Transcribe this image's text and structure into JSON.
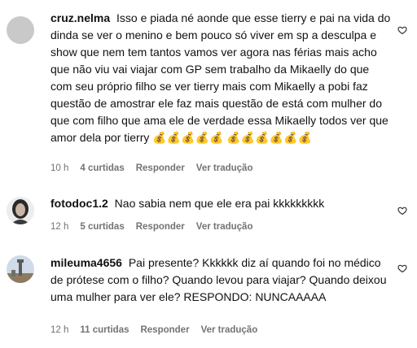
{
  "comments": [
    {
      "username": "cruz.nelma",
      "text": "Isso e piada né aonde que esse tierry e pai na vida do dinda se ver o menino e bem pouco só viver em sp a desculpa e show que nem tem tantos vamos ver agora nas férias mais acho que não viu vai viajar com GP sem trabalho da Mikaelly do que com seu próprio filho se ver tierry mais com Mikaelly a pobi faz questão de amostrar ele faz mais questão de está com mulher do que com filho que ama ele de verdade essa Mikaelly todos ver que amor dela por tierry 💰💰💰💰💰 💰💰💰💰💰💰",
      "time": "10 h",
      "likes": "4 curtidas",
      "reply": "Responder",
      "translate": "Ver tradução"
    },
    {
      "username": "fotodoc1.2",
      "text": "Nao sabia nem que ele era pai kkkkkkkkk",
      "time": "12 h",
      "likes": "5 curtidas",
      "reply": "Responder",
      "translate": "Ver tradução"
    },
    {
      "username": "mileuma4656",
      "text": "Pai presente? Kkkkkk diz aí quando foi no médico de prótese com o filho? Quando levou para viajar? Quando deixou uma mulher para ver ele? RESPONDO: NUNCAAAAA",
      "time": "12 h",
      "likes": "11 curtidas",
      "reply": "Responder",
      "translate": "Ver tradução"
    }
  ]
}
